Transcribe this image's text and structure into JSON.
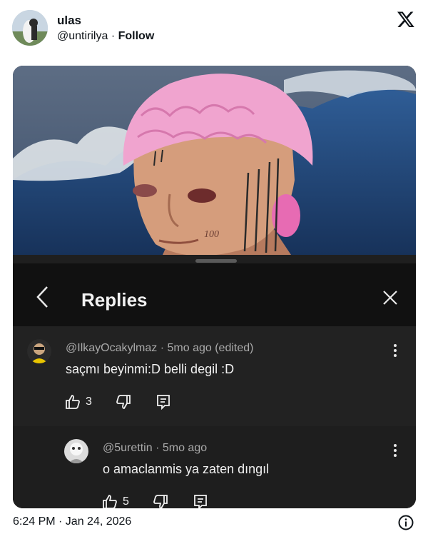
{
  "tweet": {
    "author_name": "ulas",
    "author_handle": "@untirilya",
    "separator": "·",
    "follow_label": "Follow",
    "timestamp": "6:24 PM · Jan 24, 2026"
  },
  "art": {
    "cheek_text": "100"
  },
  "replies_panel": {
    "title": "Replies",
    "comments": [
      {
        "author": "@IlkayOcakylmaz",
        "age": "5mo ago",
        "edited": "(edited)",
        "text": "saçmı beyinmi:D belli degil :D",
        "likes": "3"
      },
      {
        "author": "@5urettin",
        "age": "5mo ago",
        "text": "o amaclanmis ya zaten dıngıl",
        "likes": "5"
      }
    ]
  },
  "colors": {
    "sheet_bg": "#1f1f1f",
    "text_primary": "#f1f1f1",
    "text_secondary": "#aaaaaa"
  }
}
